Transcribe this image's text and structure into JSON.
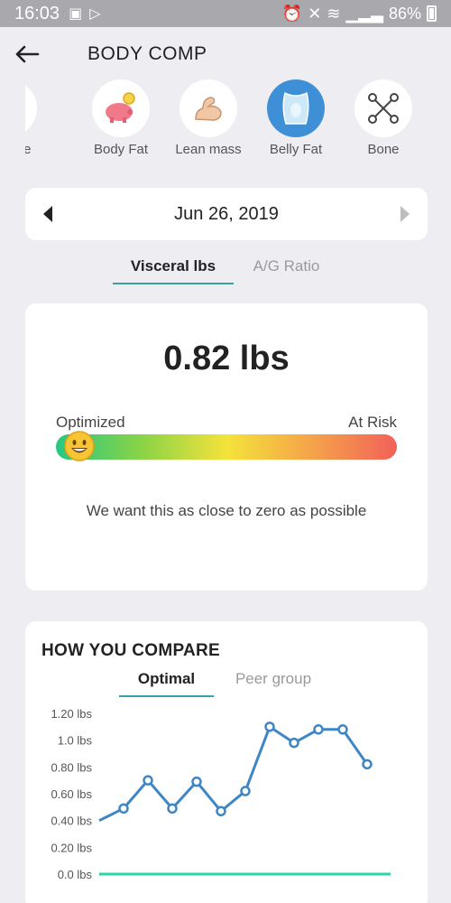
{
  "status": {
    "time": "16:03",
    "battery": "86%"
  },
  "appbar": {
    "title": "BODY COMP"
  },
  "categories": [
    {
      "label": "y Score",
      "icon": "clipboard-icon"
    },
    {
      "label": "Body Fat",
      "icon": "piggy-bank-icon"
    },
    {
      "label": "Lean mass",
      "icon": "flexed-arm-icon"
    },
    {
      "label": "Belly Fat",
      "icon": "belly-icon",
      "active": true
    },
    {
      "label": "Bone",
      "icon": "bone-icon"
    }
  ],
  "date": "Jun 26, 2019",
  "metric_tabs": [
    {
      "label": "Visceral lbs",
      "active": true
    },
    {
      "label": "A/G Ratio",
      "active": false
    }
  ],
  "metric": {
    "value": "0.82 lbs",
    "scale_left": "Optimized",
    "scale_right": "At Risk",
    "indicator_level": 0.07,
    "hint": "We want this as close to zero as possible"
  },
  "compare": {
    "title": "HOW YOU COMPARE",
    "tabs": [
      {
        "label": "Optimal",
        "active": true
      },
      {
        "label": "Peer group",
        "active": false
      }
    ]
  },
  "colors": {
    "accent": "#3f8fd6",
    "line": "#3f86c4",
    "optimal": "#2ed3a4",
    "tab_underline": "#3aa0a8"
  },
  "chart_data": {
    "type": "line",
    "ylim": [
      0,
      1.2
    ],
    "yticks": [
      "1.20 lbs",
      "1.0 lbs",
      "0.80 lbs",
      "0.60 lbs",
      "0.40 lbs",
      "0.20 lbs",
      "0.0 lbs"
    ],
    "series": [
      {
        "values": [
          0.4,
          0.49,
          0.7,
          0.49,
          0.69,
          0.47,
          0.62,
          1.1,
          0.98,
          1.08,
          1.08,
          0.82
        ]
      },
      {
        "values": [
          0.0,
          0.0
        ]
      }
    ]
  }
}
